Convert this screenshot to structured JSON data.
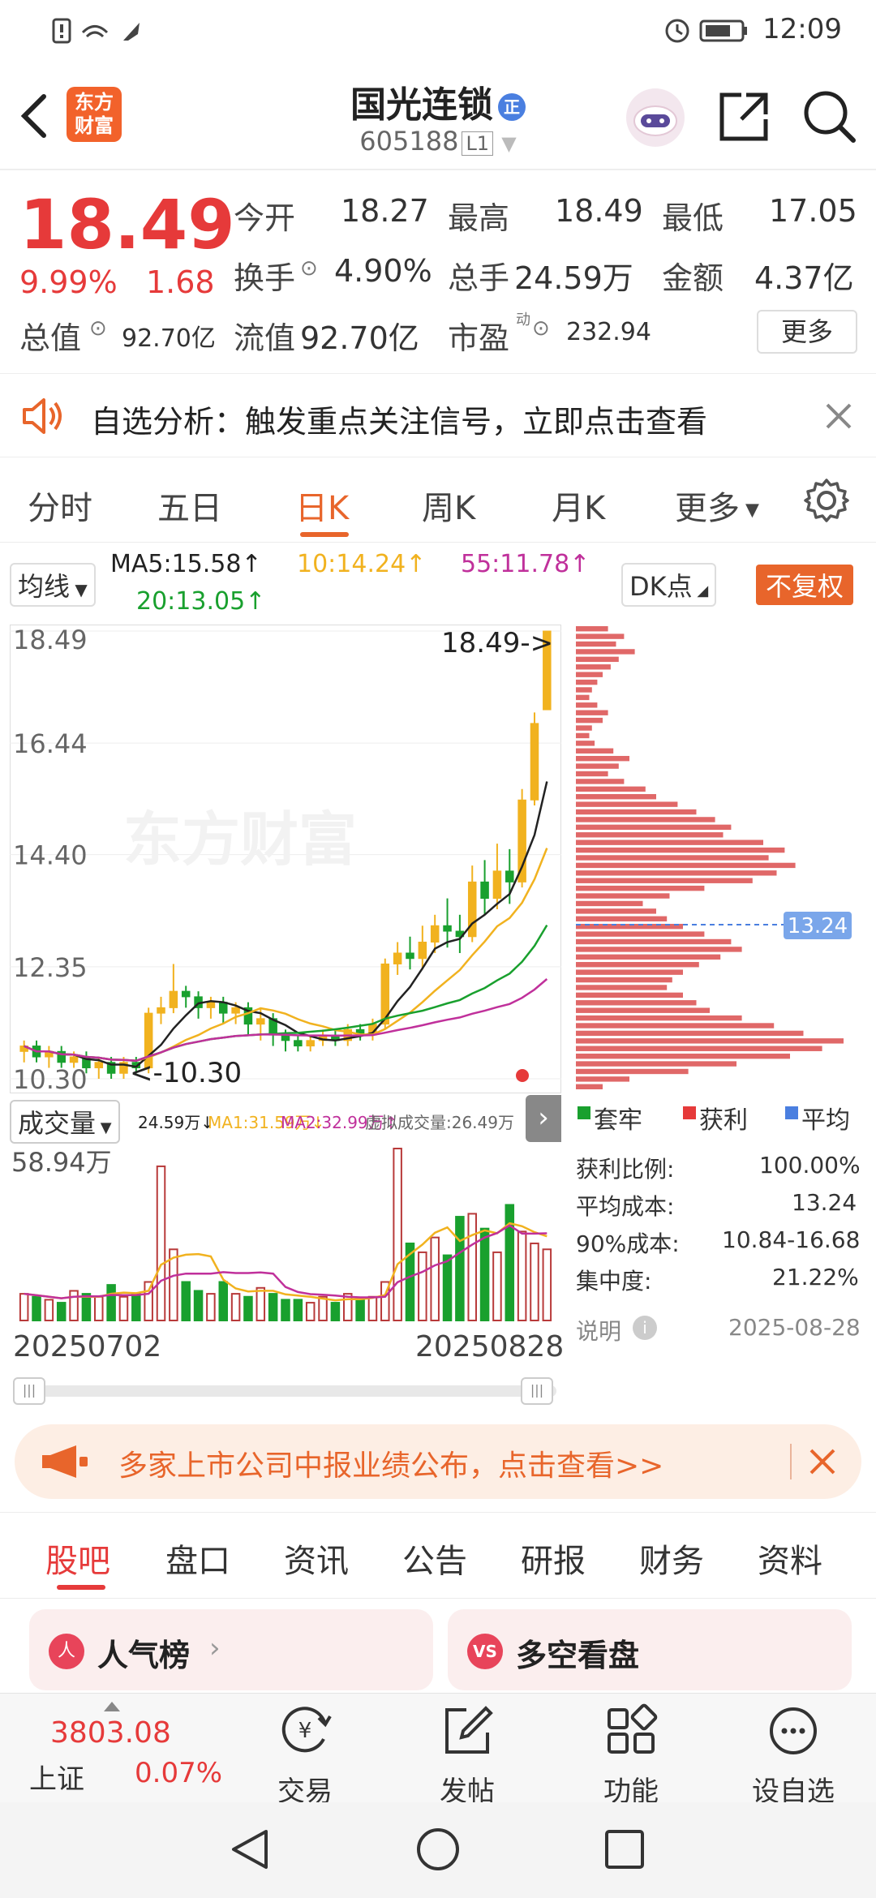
{
  "status_bar": {
    "time": "12:09"
  },
  "header": {
    "logo": [
      "东方",
      "财富"
    ],
    "stock_name": "国光连锁",
    "badge": "正",
    "stock_code": "605188",
    "level": "L1"
  },
  "quote": {
    "price": "18.49",
    "change_pct": "9.99%",
    "change": "1.68",
    "open_label": "今开",
    "open": "18.27",
    "high_label": "最高",
    "high": "18.49",
    "low_label": "最低",
    "low": "17.05",
    "turnover_label": "换手",
    "turnover": "4.90%",
    "volume_label": "总手",
    "volume": "24.59万",
    "amount_label": "金额",
    "amount": "4.37亿",
    "mktcap_label": "总值",
    "mktcap": "92.70亿",
    "float_label": "流值",
    "float": "92.70亿",
    "pe_label": "市盈",
    "pe_sup": "动",
    "pe": "232.94",
    "more": "更多"
  },
  "notice": {
    "text": "自选分析：触发重点关注信号，立即点击查看"
  },
  "kline_tabs": [
    "分时",
    "五日",
    "日K",
    "周K",
    "月K",
    "更多"
  ],
  "ma_bar": {
    "selector": "均线",
    "ma5": "MA5:15.58↑",
    "ma10": "10:14.24↑",
    "ma55": "55:11.78↑",
    "ma20": "20:13.05↑",
    "dk": "DK点",
    "fuquan": "不复权"
  },
  "colors": {
    "up": "#e63a3a",
    "down": "#19a02e",
    "accent": "#e8652b",
    "ma5": "#222222",
    "ma10": "#f1b21f",
    "ma20": "#19a02e",
    "ma55": "#c0309b"
  },
  "chart_data": {
    "type": "candlestick",
    "y_ticks": [
      "18.49",
      "16.44",
      "14.40",
      "12.35",
      "10.30"
    ],
    "ylim": [
      10.3,
      18.49
    ],
    "max_label": "18.49->",
    "min_label": "<-10.30",
    "cost_line": "13.24",
    "x_start": "20250702",
    "x_end": "20250828",
    "watermark": "东方财富",
    "candles": [
      [
        10.8,
        10.9,
        10.6,
        11.0
      ],
      [
        10.9,
        10.7,
        10.6,
        11.0
      ],
      [
        10.7,
        10.8,
        10.5,
        10.9
      ],
      [
        10.8,
        10.6,
        10.5,
        10.9
      ],
      [
        10.6,
        10.7,
        10.5,
        10.8
      ],
      [
        10.7,
        10.5,
        10.4,
        10.8
      ],
      [
        10.5,
        10.6,
        10.3,
        10.7
      ],
      [
        10.6,
        10.4,
        10.3,
        10.7
      ],
      [
        10.4,
        10.6,
        10.3,
        10.7
      ],
      [
        10.6,
        10.5,
        10.4,
        10.7
      ],
      [
        10.5,
        11.5,
        10.4,
        11.6
      ],
      [
        11.5,
        11.6,
        11.3,
        11.8
      ],
      [
        11.6,
        11.9,
        11.5,
        12.4
      ],
      [
        11.9,
        11.8,
        11.6,
        12.0
      ],
      [
        11.8,
        11.6,
        11.4,
        11.9
      ],
      [
        11.6,
        11.7,
        11.4,
        11.8
      ],
      [
        11.7,
        11.5,
        11.3,
        11.8
      ],
      [
        11.5,
        11.6,
        11.3,
        11.7
      ],
      [
        11.6,
        11.3,
        11.1,
        11.7
      ],
      [
        11.3,
        11.4,
        11.0,
        11.6
      ],
      [
        11.4,
        11.1,
        10.9,
        11.5
      ],
      [
        11.1,
        11.0,
        10.8,
        11.2
      ],
      [
        11.0,
        10.9,
        10.8,
        11.1
      ],
      [
        10.9,
        11.0,
        10.8,
        11.1
      ],
      [
        11.0,
        11.1,
        10.9,
        11.2
      ],
      [
        11.1,
        11.0,
        10.9,
        11.2
      ],
      [
        11.0,
        11.2,
        10.9,
        11.3
      ],
      [
        11.2,
        11.1,
        11.0,
        11.3
      ],
      [
        11.1,
        11.3,
        11.0,
        11.4
      ],
      [
        11.3,
        12.4,
        11.2,
        12.5
      ],
      [
        12.4,
        12.6,
        12.2,
        12.8
      ],
      [
        12.6,
        12.5,
        12.3,
        12.9
      ],
      [
        12.5,
        12.8,
        12.3,
        13.1
      ],
      [
        12.8,
        13.1,
        12.6,
        13.3
      ],
      [
        13.1,
        13.0,
        12.7,
        13.6
      ],
      [
        13.0,
        12.9,
        12.6,
        13.3
      ],
      [
        12.9,
        13.9,
        12.8,
        14.2
      ],
      [
        13.9,
        13.6,
        13.3,
        14.3
      ],
      [
        13.6,
        14.1,
        13.4,
        14.6
      ],
      [
        14.1,
        13.9,
        13.5,
        14.5
      ],
      [
        13.9,
        15.4,
        13.8,
        15.6
      ],
      [
        15.4,
        16.8,
        15.3,
        17.0
      ],
      [
        17.05,
        18.49,
        17.05,
        18.49
      ]
    ],
    "volume": {
      "max_label": "58.94万",
      "vol_label": "24.59万↓",
      "ma1": "MA1:31.59万↓",
      "ma2": "MA2:32.99万↑",
      "virtual": "虚拟成交量:26.49万",
      "values": [
        9,
        8,
        7,
        6,
        10,
        9,
        8,
        12,
        8,
        9,
        13,
        52,
        24,
        13,
        10,
        9,
        13,
        9,
        8,
        11,
        9,
        7,
        7,
        6,
        8,
        6,
        9,
        7,
        8,
        13,
        58,
        26,
        23,
        28,
        22,
        35,
        36,
        31,
        23,
        39,
        30,
        26,
        24
      ]
    }
  },
  "distribution": {
    "legend": [
      "套牢",
      "获利",
      "平均"
    ],
    "rows": [
      {
        "label": "获利比例:",
        "value": "100.00%"
      },
      {
        "label": "平均成本:",
        "value": "13.24"
      },
      {
        "label": "90%成本:",
        "value": "10.84-16.68"
      },
      {
        "label": "集中度:",
        "value": "21.22%"
      }
    ],
    "note_label": "说明",
    "date": "2025-08-28",
    "bars": [
      0.12,
      0.18,
      0.15,
      0.22,
      0.16,
      0.13,
      0.1,
      0.08,
      0.06,
      0.05,
      0.08,
      0.12,
      0.1,
      0.06,
      0.05,
      0.07,
      0.14,
      0.2,
      0.16,
      0.12,
      0.18,
      0.26,
      0.3,
      0.38,
      0.45,
      0.52,
      0.58,
      0.55,
      0.7,
      0.78,
      0.72,
      0.82,
      0.75,
      0.66,
      0.48,
      0.35,
      0.25,
      0.3,
      0.34,
      0.4,
      0.48,
      0.58,
      0.62,
      0.54,
      0.46,
      0.4,
      0.36,
      0.34,
      0.4,
      0.45,
      0.5,
      0.62,
      0.74,
      0.85,
      1.0,
      0.92,
      0.8,
      0.6,
      0.42,
      0.2,
      0.1
    ]
  },
  "banner": {
    "text": "多家上市公司中报业绩公布，点击查看>>"
  },
  "bottom_tabs": [
    "股吧",
    "盘口",
    "资讯",
    "公告",
    "研报",
    "财务",
    "资料"
  ],
  "cards": [
    {
      "icon": "人",
      "title": "人气榜"
    },
    {
      "icon": "VS",
      "title": "多空看盘"
    }
  ],
  "bottom_nav": {
    "index_value": "3803.08",
    "index_name": "上证",
    "index_change": "0.07%",
    "items": [
      "交易",
      "发帖",
      "功能",
      "设自选"
    ]
  }
}
